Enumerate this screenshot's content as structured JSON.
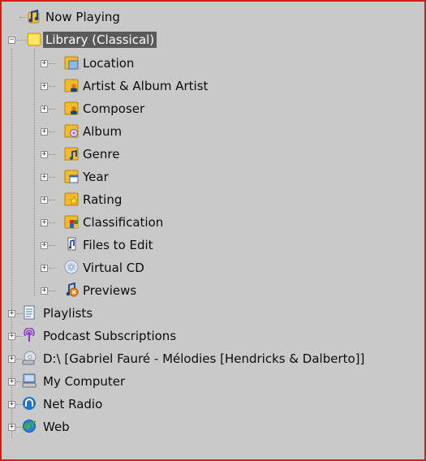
{
  "tree": {
    "items": [
      {
        "label": "Now Playing",
        "icon": "now-playing-icon",
        "level": 0,
        "expander": "none"
      },
      {
        "label": "Library (Classical)",
        "icon": "library-folder-icon",
        "level": 0,
        "expander": "minus",
        "selected": true
      },
      {
        "label": "Location",
        "icon": "location-folder-icon",
        "level": 1,
        "expander": "plus"
      },
      {
        "label": "Artist & Album Artist",
        "icon": "artist-folder-icon",
        "level": 1,
        "expander": "plus"
      },
      {
        "label": "Composer",
        "icon": "composer-folder-icon",
        "level": 1,
        "expander": "plus"
      },
      {
        "label": "Album",
        "icon": "album-folder-icon",
        "level": 1,
        "expander": "plus"
      },
      {
        "label": "Genre",
        "icon": "genre-folder-icon",
        "level": 1,
        "expander": "plus"
      },
      {
        "label": "Year",
        "icon": "year-folder-icon",
        "level": 1,
        "expander": "plus"
      },
      {
        "label": "Rating",
        "icon": "rating-folder-icon",
        "level": 1,
        "expander": "plus"
      },
      {
        "label": "Classification",
        "icon": "classification-folder-icon",
        "level": 1,
        "expander": "plus"
      },
      {
        "label": "Files to Edit",
        "icon": "files-to-edit-icon",
        "level": 1,
        "expander": "plus"
      },
      {
        "label": "Virtual CD",
        "icon": "virtual-cd-icon",
        "level": 1,
        "expander": "plus"
      },
      {
        "label": "Previews",
        "icon": "previews-icon",
        "level": 1,
        "expander": "plus"
      },
      {
        "label": "Playlists",
        "icon": "playlists-icon",
        "level": 0,
        "expander": "plus"
      },
      {
        "label": "Podcast Subscriptions",
        "icon": "podcast-icon",
        "level": 0,
        "expander": "plus"
      },
      {
        "label": "D:\\ [Gabriel Fauré - Mélodies [Hendricks & Dalberto]]",
        "icon": "cd-drive-icon",
        "level": 0,
        "expander": "plus"
      },
      {
        "label": "My Computer",
        "icon": "my-computer-icon",
        "level": 0,
        "expander": "plus"
      },
      {
        "label": "Net Radio",
        "icon": "net-radio-icon",
        "level": 0,
        "expander": "plus"
      },
      {
        "label": "Web",
        "icon": "web-icon",
        "level": 0,
        "expander": "plus"
      }
    ]
  },
  "colors": {
    "background": "#c9c9c9",
    "selection": "#5a5a5a",
    "border": "#d9191c"
  }
}
